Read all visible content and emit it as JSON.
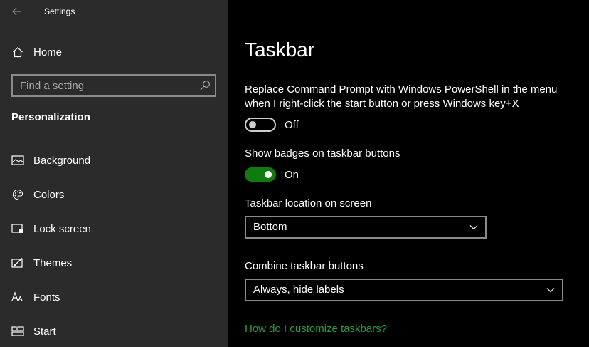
{
  "app": {
    "title": "Settings"
  },
  "sidebar": {
    "home_label": "Home",
    "search": {
      "placeholder": "Find a setting",
      "value": ""
    },
    "section_title": "Personalization",
    "items": [
      {
        "label": "Background",
        "icon": "picture-icon"
      },
      {
        "label": "Colors",
        "icon": "palette-icon"
      },
      {
        "label": "Lock screen",
        "icon": "lock-screen-icon"
      },
      {
        "label": "Themes",
        "icon": "themes-icon"
      },
      {
        "label": "Fonts",
        "icon": "fonts-icon"
      },
      {
        "label": "Start",
        "icon": "start-icon"
      }
    ]
  },
  "main": {
    "title": "Taskbar",
    "settings": {
      "powershell": {
        "label": "Replace Command Prompt with Windows PowerShell in the menu when I right-click the start button or press Windows key+X",
        "state": "Off",
        "checked": false
      },
      "badges": {
        "label": "Show badges on taskbar buttons",
        "state": "On",
        "checked": true
      },
      "location": {
        "label": "Taskbar location on screen",
        "value": "Bottom"
      },
      "combine": {
        "label": "Combine taskbar buttons",
        "value": "Always, hide labels"
      }
    },
    "help_link": "How do I customize taskbars?"
  },
  "colors": {
    "sidebar_bg": "#2b2b2b",
    "main_bg": "#000000",
    "accent_green": "#107c10",
    "link_green": "#2d9d3c"
  }
}
